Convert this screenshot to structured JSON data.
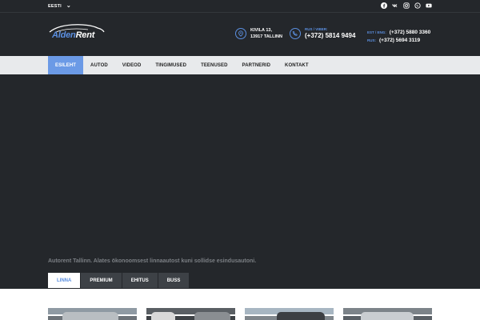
{
  "topbar": {
    "language": "EESTI",
    "social_icons": [
      "facebook-icon",
      "vk-icon",
      "instagram-icon",
      "whatsapp-icon",
      "youtube-icon"
    ]
  },
  "header": {
    "logo": {
      "part1": "Alden",
      "part2": "Rent"
    },
    "address": {
      "line1": "KIVILA 13,",
      "line2": "13917 TALLINN"
    },
    "phone_main": {
      "label": "RUS / VIBER:",
      "number": "(+372) 5814 9494"
    },
    "phones_extra": [
      {
        "label": "EST / ENG:",
        "number": "(+372) 5880 3360"
      },
      {
        "label": "RUS:",
        "number": "(+372) 5694 3119"
      }
    ]
  },
  "nav": {
    "items": [
      "ESILEHT",
      "AUTOD",
      "VIDEOD",
      "TINGIMUSED",
      "TEENUSED",
      "PARTNERID",
      "KONTAKT"
    ],
    "active_index": 0
  },
  "hero": {
    "tagline": "Autorent Tallinn. Alates ökonoomsest linnaautost kuni sollidse esindusautoni."
  },
  "tabs": {
    "items": [
      "LINNA",
      "PREMIUM",
      "EHITUS",
      "BUSS"
    ],
    "active_index": 0
  },
  "colors": {
    "accent": "#5b8fe0",
    "nav_active": "#6b9ae6",
    "dark_bg": "#24272b",
    "nav_bg": "#e8eaec"
  }
}
